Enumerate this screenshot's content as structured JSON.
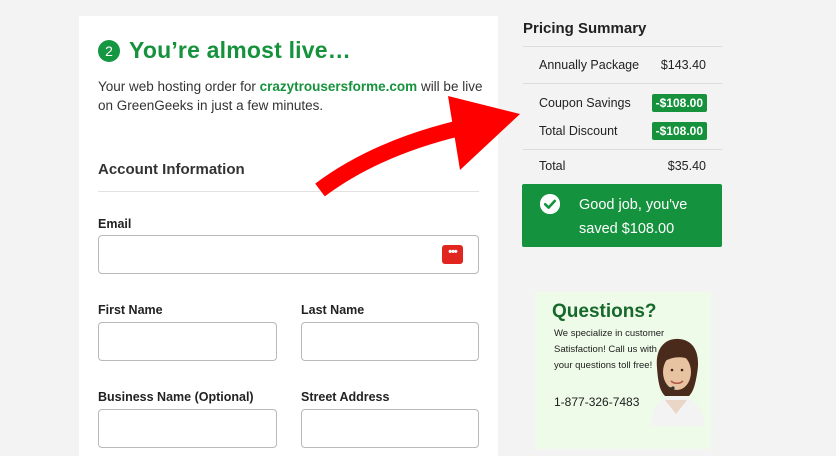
{
  "step": {
    "number": "2",
    "title": "You’re almost live…"
  },
  "intro": {
    "before": "Your web hosting order for ",
    "domain": "crazytrousersforme.com",
    "after": " will be live on GreenGeeks in just a few minutes."
  },
  "account": {
    "title": "Account Information",
    "fields": {
      "email_label": "Email",
      "email_value": "",
      "first_label": "First Name",
      "first_value": "",
      "last_label": "Last Name",
      "last_value": "",
      "business_label": "Business Name (Optional)",
      "business_value": "",
      "street_label": "Street Address",
      "street_value": ""
    },
    "password_manager_glyph": "•••"
  },
  "summary": {
    "title": "Pricing Summary",
    "annual_label": "Annually Package",
    "annual_value": "$143.40",
    "coupon_label": "Coupon Savings",
    "coupon_value": "-$108.00",
    "discount_label": "Total Discount",
    "discount_value": "-$108.00",
    "total_label": "Total",
    "total_value": "$35.40"
  },
  "success": {
    "message": "Good job, you've saved $108.00"
  },
  "ad": {
    "title": "Questions?",
    "desc": "We specialize in customer Satisfaction! Call us with your questions toll free!",
    "phone": "1-877-326-7483"
  },
  "colors": {
    "brand_green": "#16923d",
    "arrow_red": "#ff0000",
    "icon_red": "#e0261e"
  },
  "icons": [
    "check-circle-icon",
    "password-manager-icon",
    "red-arrow"
  ]
}
